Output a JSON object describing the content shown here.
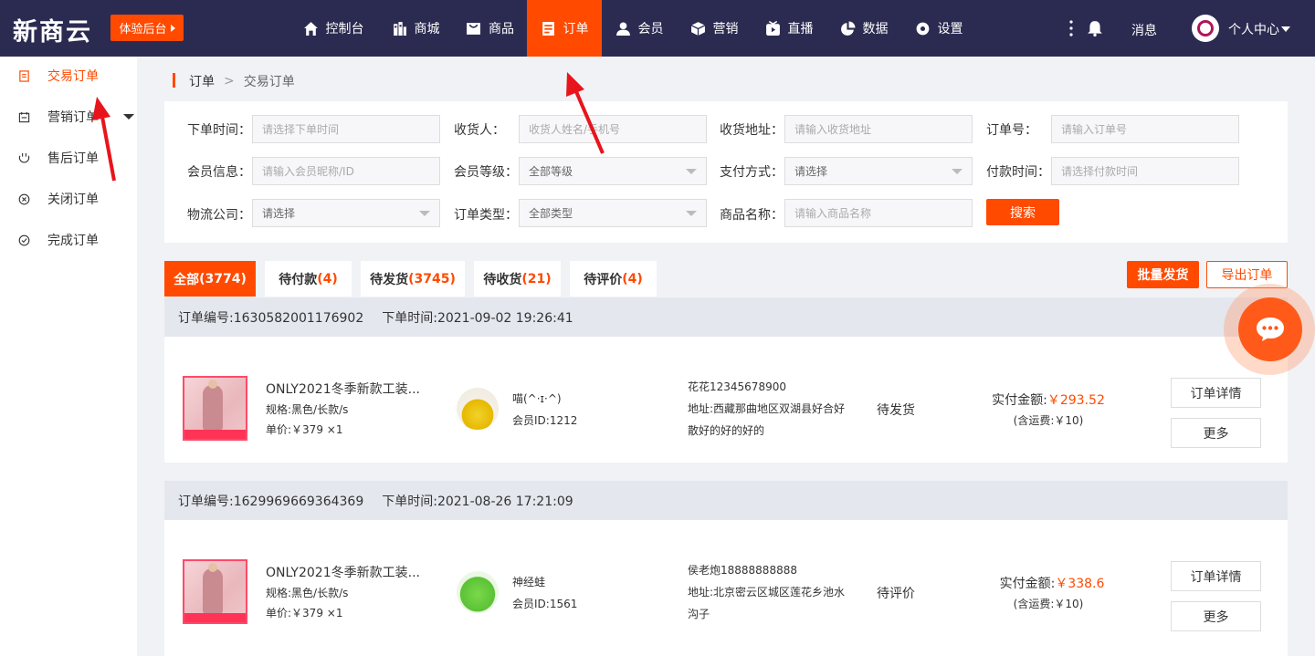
{
  "logo": "新商云",
  "trial_button": "体验后台",
  "nav": {
    "items": [
      {
        "label": "控制台",
        "icon": "home-icon"
      },
      {
        "label": "商城",
        "icon": "store-icon"
      },
      {
        "label": "商品",
        "icon": "product-icon"
      },
      {
        "label": "订单",
        "icon": "order-icon",
        "active": true
      },
      {
        "label": "会员",
        "icon": "user-icon"
      },
      {
        "label": "营销",
        "icon": "cube-icon"
      },
      {
        "label": "直播",
        "icon": "live-icon"
      },
      {
        "label": "数据",
        "icon": "pie-chart-icon"
      },
      {
        "label": "设置",
        "icon": "gear-icon"
      }
    ],
    "messages": "消息",
    "user_center": "个人中心"
  },
  "sidebar": {
    "items": [
      {
        "label": "交易订单",
        "icon": "document-icon",
        "active": true
      },
      {
        "label": "营销订单",
        "icon": "calendar-icon"
      },
      {
        "label": "售后订单",
        "icon": "refund-icon"
      },
      {
        "label": "关闭订单",
        "icon": "close-circle-icon"
      },
      {
        "label": "完成订单",
        "icon": "check-circle-icon"
      }
    ]
  },
  "breadcrumb": {
    "parent": "订单",
    "separator": ">",
    "current": "交易订单"
  },
  "filters": {
    "order_time": {
      "label": "下单时间：",
      "placeholder": "请选择下单时间"
    },
    "receiver": {
      "label": "收货人：",
      "placeholder": "收货人姓名/手机号"
    },
    "address": {
      "label": "收货地址：",
      "placeholder": "请输入收货地址"
    },
    "order_no": {
      "label": "订单号：",
      "placeholder": "请输入订单号"
    },
    "member_info": {
      "label": "会员信息：",
      "placeholder": "请输入会员昵称/ID"
    },
    "member_level": {
      "label": "会员等级：",
      "value": "全部等级"
    },
    "pay_method": {
      "label": "支付方式：",
      "value": "请选择"
    },
    "pay_time": {
      "label": "付款时间：",
      "placeholder": "请选择付款时间"
    },
    "logistics": {
      "label": "物流公司：",
      "value": "请选择"
    },
    "order_type": {
      "label": "订单类型：",
      "value": "全部类型"
    },
    "product_name": {
      "label": "商品名称：",
      "placeholder": "请输入商品名称"
    },
    "search_button": "搜索"
  },
  "tabs": [
    {
      "label": "全部",
      "count": "(3774)",
      "active": true
    },
    {
      "label": "待付款",
      "count": "(4)"
    },
    {
      "label": "待发货",
      "count": "(3745)"
    },
    {
      "label": "待收货",
      "count": "(21)"
    },
    {
      "label": "待评价",
      "count": "(4)"
    }
  ],
  "actions": {
    "bulk_ship": "批量发货",
    "export": "导出订单"
  },
  "orders": [
    {
      "order_no": "订单编号:1630582001176902",
      "order_time": "下单时间:2021-09-02 19:26:41",
      "product_title": "ONLY2021冬季新款工装...",
      "spec": "规格:黑色/长款/s",
      "price": "单价:￥379   ×1",
      "member_name": "喵(^·ɪ·^)",
      "member_id": "会员ID:1212",
      "receiver": "花花12345678900",
      "address": "地址:西藏那曲地区双湖县好合好散好的好的好的",
      "status": "待发货",
      "paid_label": "实付金额:",
      "paid_amount": "￥293.52",
      "shipping": "(含运费:￥10)",
      "detail_button": "订单详情",
      "more_button": "更多"
    },
    {
      "order_no": "订单编号:1629969669364369",
      "order_time": "下单时间:2021-08-26 17:21:09",
      "product_title": "ONLY2021冬季新款工装...",
      "spec": "规格:黑色/长款/s",
      "price": "单价:￥379   ×1",
      "member_name": "神经蛙",
      "member_id": "会员ID:1561",
      "receiver": "侯老炮18888888888",
      "address": "地址:北京密云区城区莲花乡池水沟子",
      "status": "待评价",
      "paid_label": "实付金额:",
      "paid_amount": "￥338.6",
      "shipping": "(含运费:￥10)",
      "detail_button": "订单详情",
      "more_button": "更多"
    }
  ],
  "colors": {
    "accent": "#ff4a00",
    "topbar": "#2b2b52",
    "arrow": "#e8141c"
  }
}
